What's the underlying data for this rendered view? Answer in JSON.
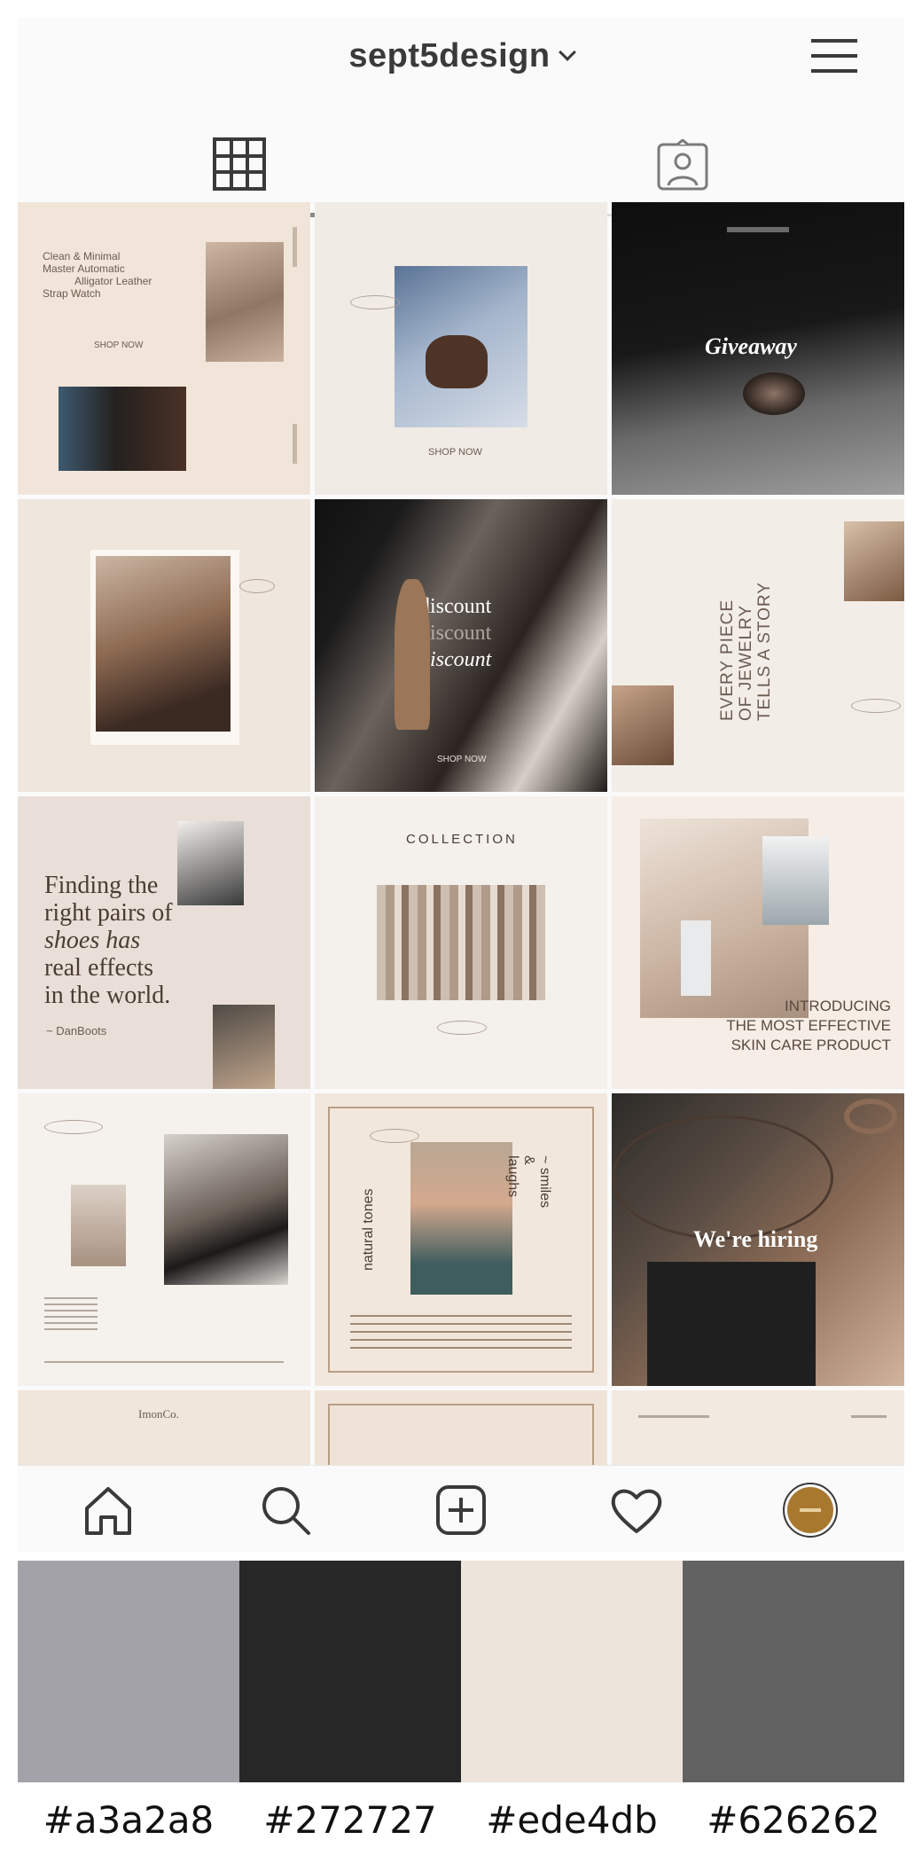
{
  "header": {
    "username": "sept5design"
  },
  "posts": [
    {
      "kind": "watch",
      "lines": [
        "Clean & Minimal",
        "Master Automatic",
        "Alligator Leather",
        "Strap Watch"
      ],
      "cta": "SHOP NOW"
    },
    {
      "kind": "shop",
      "cta": "SHOP NOW"
    },
    {
      "kind": "giveaway",
      "title": "Giveaway"
    },
    {
      "kind": "portrait"
    },
    {
      "kind": "discount",
      "title": "discount",
      "cta": "SHOP NOW"
    },
    {
      "kind": "jewelry",
      "lines": [
        "EVERY PIECE",
        "OF JEWELRY",
        "TELLS A STORY"
      ]
    },
    {
      "kind": "quote",
      "lines": [
        "Finding the",
        "right pairs of",
        "shoes has",
        "real effects",
        "in the world."
      ],
      "author": "~ DanBoots"
    },
    {
      "kind": "collection",
      "title": "COLLECTION"
    },
    {
      "kind": "skincare",
      "lines": [
        "INTRODUCING",
        "THE MOST EFFECTIVE",
        "SKIN CARE PRODUCT"
      ]
    },
    {
      "kind": "shoe"
    },
    {
      "kind": "natural",
      "side_left": "natural tones",
      "side_right": "~ smiles & laughs"
    },
    {
      "kind": "hiring",
      "title": "We're hiring"
    },
    {
      "kind": "partial-a",
      "title": "ImonCo."
    },
    {
      "kind": "partial-b"
    },
    {
      "kind": "partial-c"
    }
  ],
  "bottom_nav": [
    "home",
    "search",
    "new-post",
    "activity",
    "profile"
  ],
  "palette": [
    {
      "hex": "#a3a2a8",
      "label": "#a3a2a8"
    },
    {
      "hex": "#272727",
      "label": "#272727"
    },
    {
      "hex": "#ede4db",
      "label": "#ede4db"
    },
    {
      "hex": "#626262",
      "label": "#626262"
    }
  ]
}
